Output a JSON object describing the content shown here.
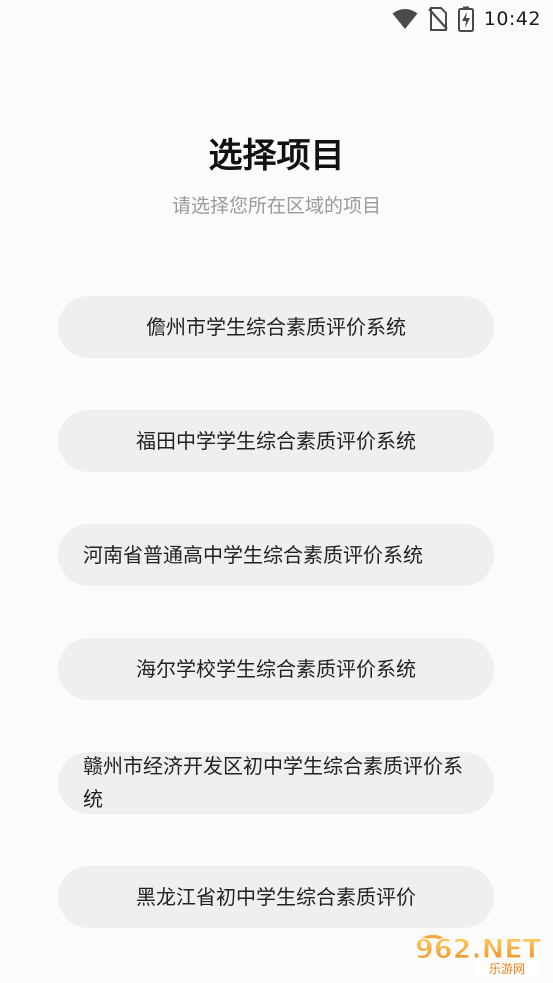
{
  "status_bar": {
    "time": "10:42",
    "icons": [
      "wifi-icon",
      "no-sim-icon",
      "battery-charging-icon"
    ]
  },
  "header": {
    "title": "选择项目",
    "subtitle": "请选择您所在区域的项目"
  },
  "projects": [
    {
      "label": "儋州市学生综合素质评价系统"
    },
    {
      "label": "福田中学学生综合素质评价系统"
    },
    {
      "label": "河南省普通高中学生综合素质评价系统"
    },
    {
      "label": "海尔学校学生综合素质评价系统"
    },
    {
      "label": "赣州市经济开发区初中学生综合素质评价系统"
    },
    {
      "label": "黑龙江省初中学生综合素质评价"
    }
  ],
  "watermark": {
    "brand": "962.NET",
    "caption": "乐游网"
  }
}
